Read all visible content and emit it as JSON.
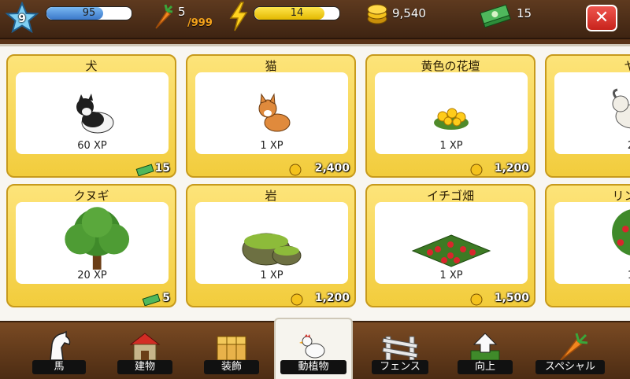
{
  "hud": {
    "level": "9",
    "xp_value": "95",
    "xp_progress": 0.67,
    "carrots": "5",
    "carrots_max": "/999",
    "energy_value": "14",
    "energy_progress": 0.82,
    "coins": "9,540",
    "cash": "15"
  },
  "colors": {
    "card": "#f5d24f",
    "close": "#e03a32",
    "xp_fill": "#4a8ad8",
    "energy_fill": "#f2cc1c"
  },
  "cards": [
    {
      "title": "犬",
      "xp": "60 XP",
      "price": "15",
      "currency": "cash",
      "icon": "dog-icon"
    },
    {
      "title": "猫",
      "xp": "1 XP",
      "price": "2,400",
      "currency": "coin",
      "icon": "cat-icon"
    },
    {
      "title": "黄色の花壇",
      "xp": "1 XP",
      "price": "1,200",
      "currency": "coin",
      "icon": "flowerbed-icon"
    },
    {
      "title": "ヤ",
      "xp": "2",
      "price": "",
      "currency": "",
      "icon": "goat-icon"
    },
    {
      "title": "クヌギ",
      "xp": "20 XP",
      "price": "5",
      "currency": "cash",
      "icon": "tree-icon"
    },
    {
      "title": "岩",
      "xp": "1 XP",
      "price": "1,200",
      "currency": "coin",
      "icon": "rock-icon"
    },
    {
      "title": "イチゴ畑",
      "xp": "1 XP",
      "price": "1,500",
      "currency": "coin",
      "icon": "strawberry-field-icon"
    },
    {
      "title": "リンゴ",
      "xp": "1",
      "price": "",
      "currency": "",
      "icon": "apple-tree-icon"
    }
  ],
  "tabs": [
    {
      "label": "馬",
      "icon": "horse-icon"
    },
    {
      "label": "建物",
      "icon": "barn-icon"
    },
    {
      "label": "装飾",
      "icon": "hay-bale-icon"
    },
    {
      "label": "動植物",
      "icon": "chicken-icon",
      "active": true
    },
    {
      "label": "フェンス",
      "icon": "fence-icon"
    },
    {
      "label": "向上",
      "icon": "upgrade-arrow-icon"
    },
    {
      "label": "スペシャル",
      "icon": "carrot-icon"
    }
  ]
}
